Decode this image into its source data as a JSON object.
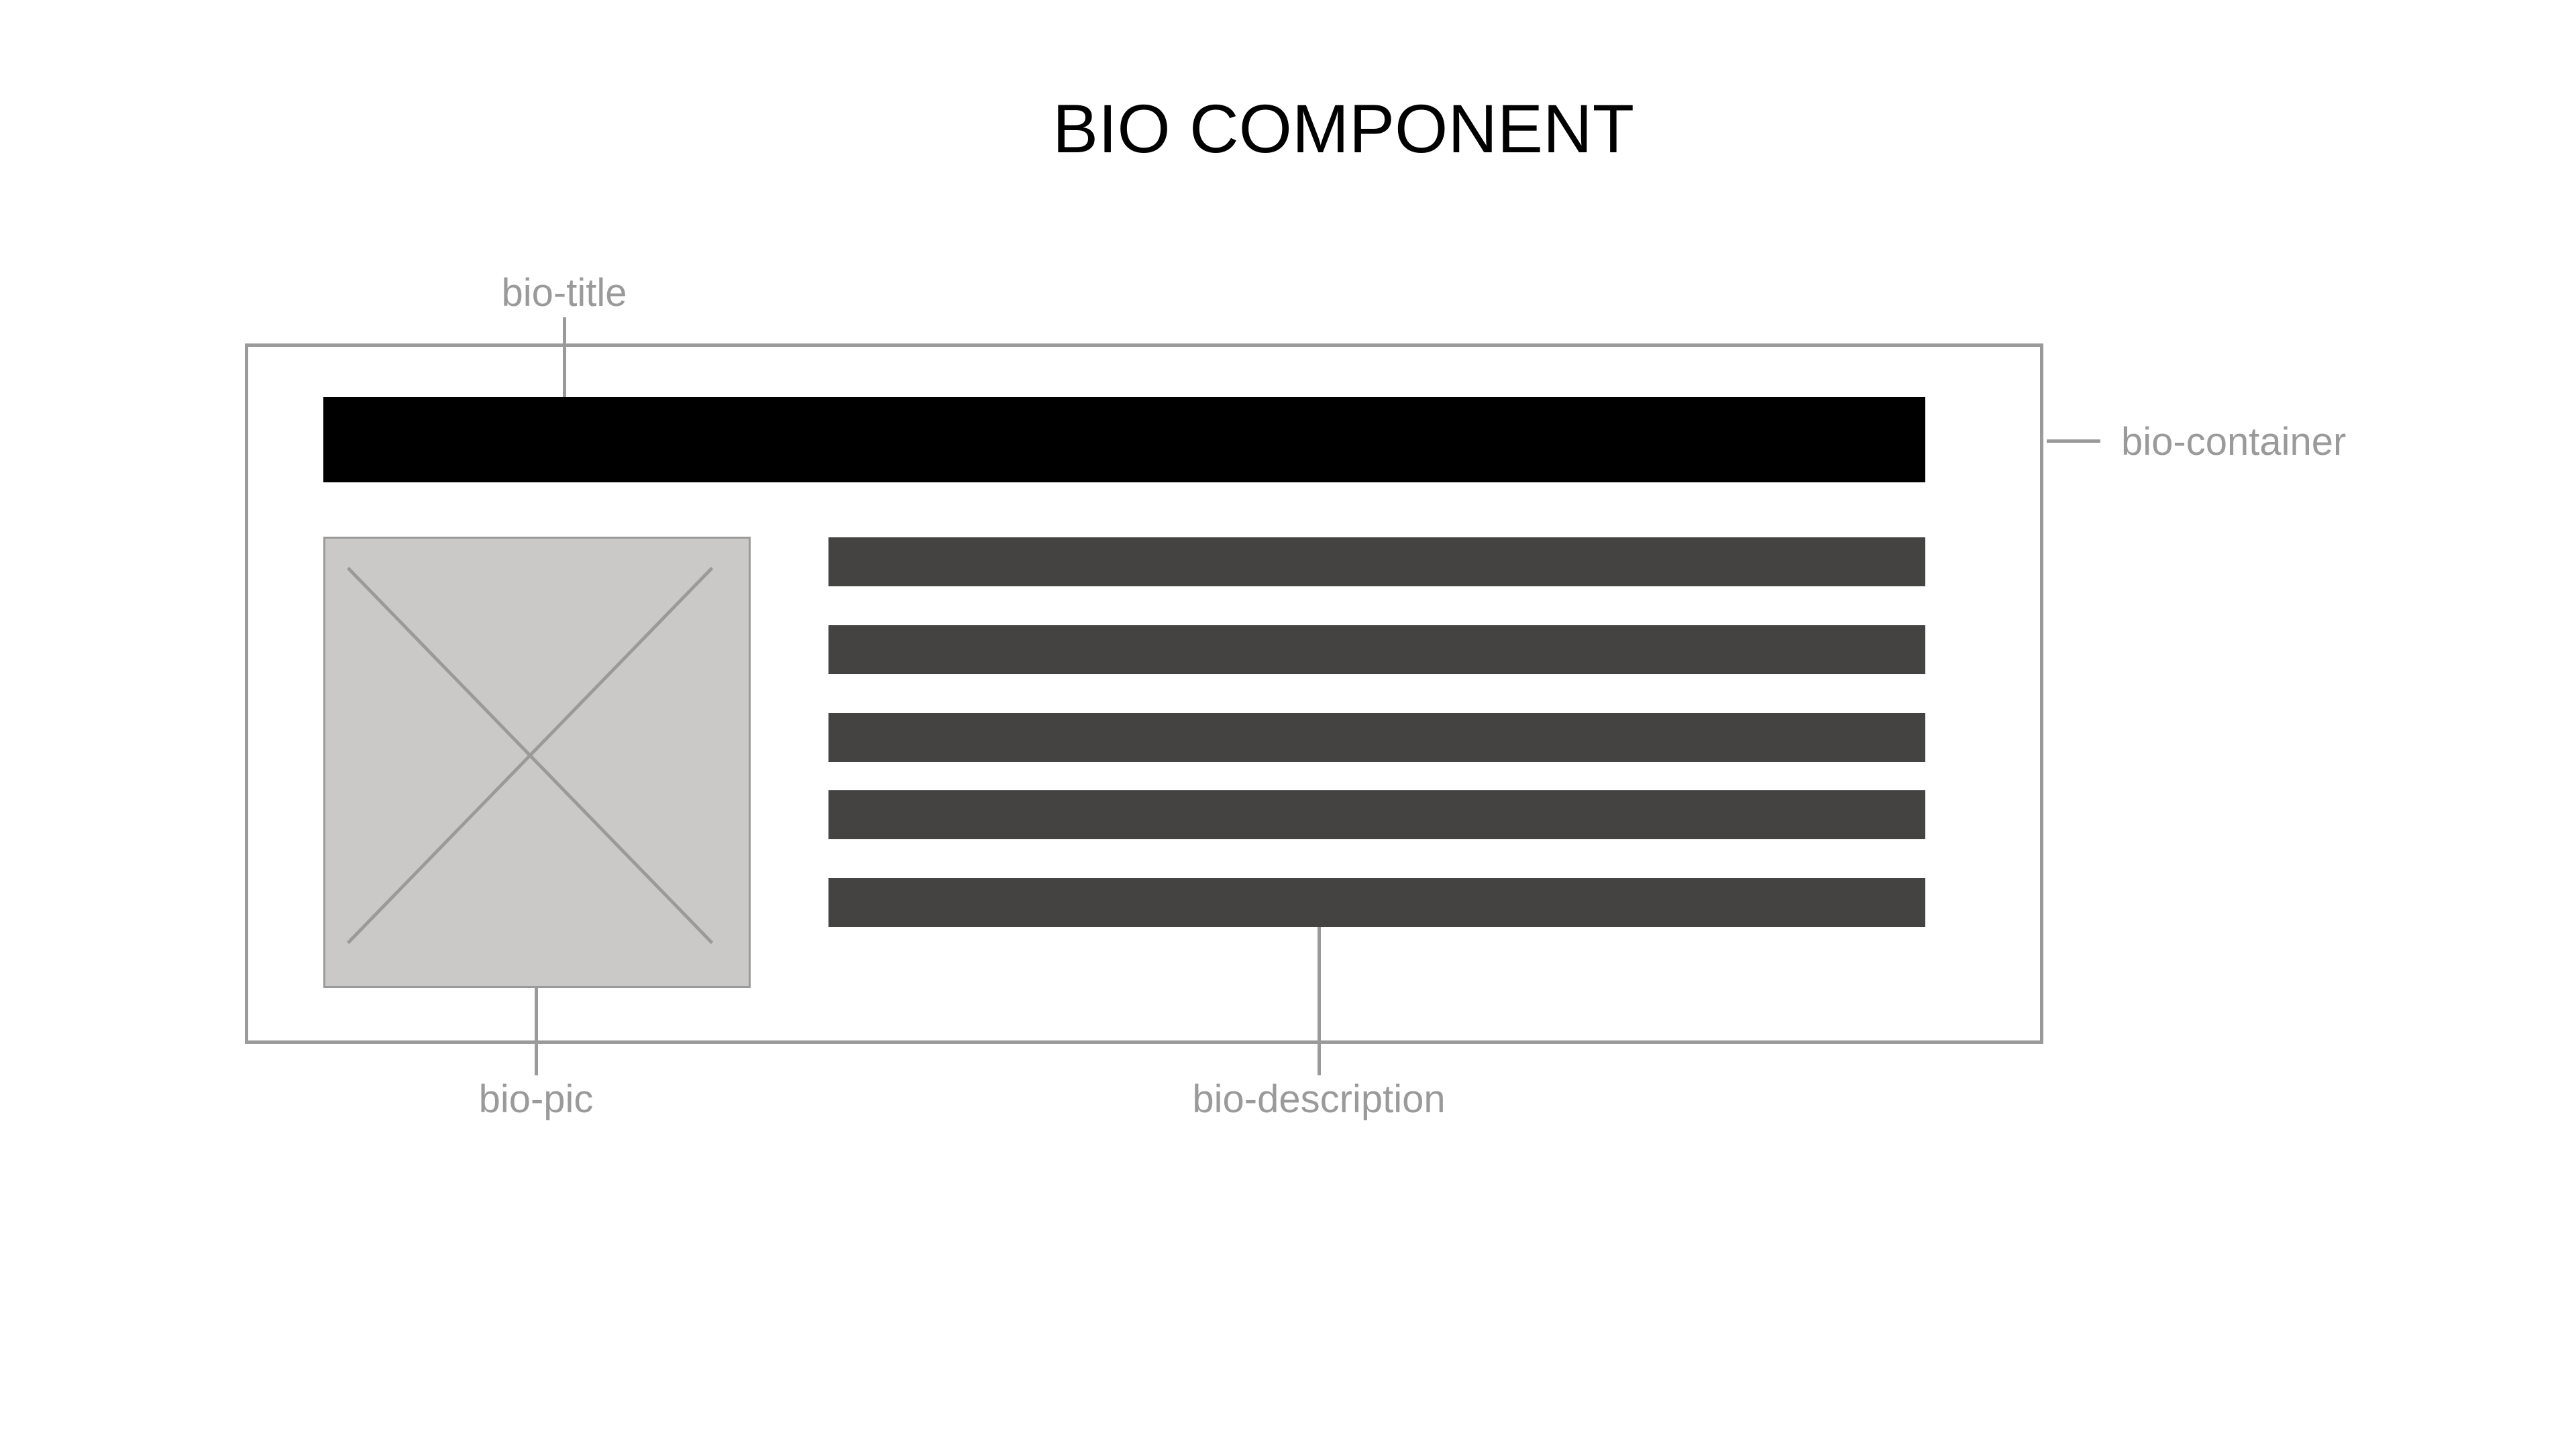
{
  "diagram": {
    "title": "BIO COMPONENT",
    "labels": {
      "bio_title": "bio-title",
      "bio_container": "bio-container",
      "bio_pic": "bio-pic",
      "bio_description": "bio-description"
    },
    "colors": {
      "title_bar": "#000000",
      "description_lines": "#444342",
      "picture_placeholder": "#cbc9c8",
      "outline_and_labels": "#9a9a9a"
    },
    "icons": {
      "picture": "image-placeholder-x-icon"
    }
  }
}
